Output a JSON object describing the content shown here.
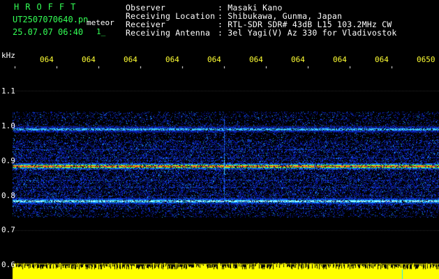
{
  "app": {
    "name": "HROFFT",
    "filename": "UT2507070640.pn",
    "overlay_label": "meteor",
    "datetime": "25.07.07 06:40",
    "small_marker": "1_"
  },
  "info": [
    {
      "label": "Observer",
      "value": ": Masaki Kano"
    },
    {
      "label": "Receiving Location",
      "value": ": Shibukawa, Gunma, Japan"
    },
    {
      "label": "Receiver",
      "value": ": RTL-SDR SDR# 43dB L15 103.2MHz CW"
    },
    {
      "label": "Receiving Antenna",
      "value": ": 3el Yagi(V) Az 330 for Vladivostok"
    }
  ],
  "time_axis": {
    "ticks": [
      "064",
      "064",
      "064",
      "064",
      "064",
      "064",
      "064",
      "064",
      "064",
      "0650"
    ]
  },
  "freq_axis": {
    "unit": "kHz",
    "ticks": [
      "1.1",
      "1.0",
      "0.9",
      "0.8",
      "0.7",
      "0.6"
    ]
  },
  "colors": {
    "header_green": "#33ff55",
    "info_white": "#ffffff",
    "tick_yellow": "#ffff33",
    "spectrum_blue": "#0a1aa8",
    "signal_red": "#ff2a2a",
    "level_bar_yellow": "#ffff00"
  },
  "spectrogram": {
    "carrier_lines_khz": [
      0.99,
      0.885,
      0.785
    ],
    "meteor_trace_minute_fraction": 0.51
  }
}
